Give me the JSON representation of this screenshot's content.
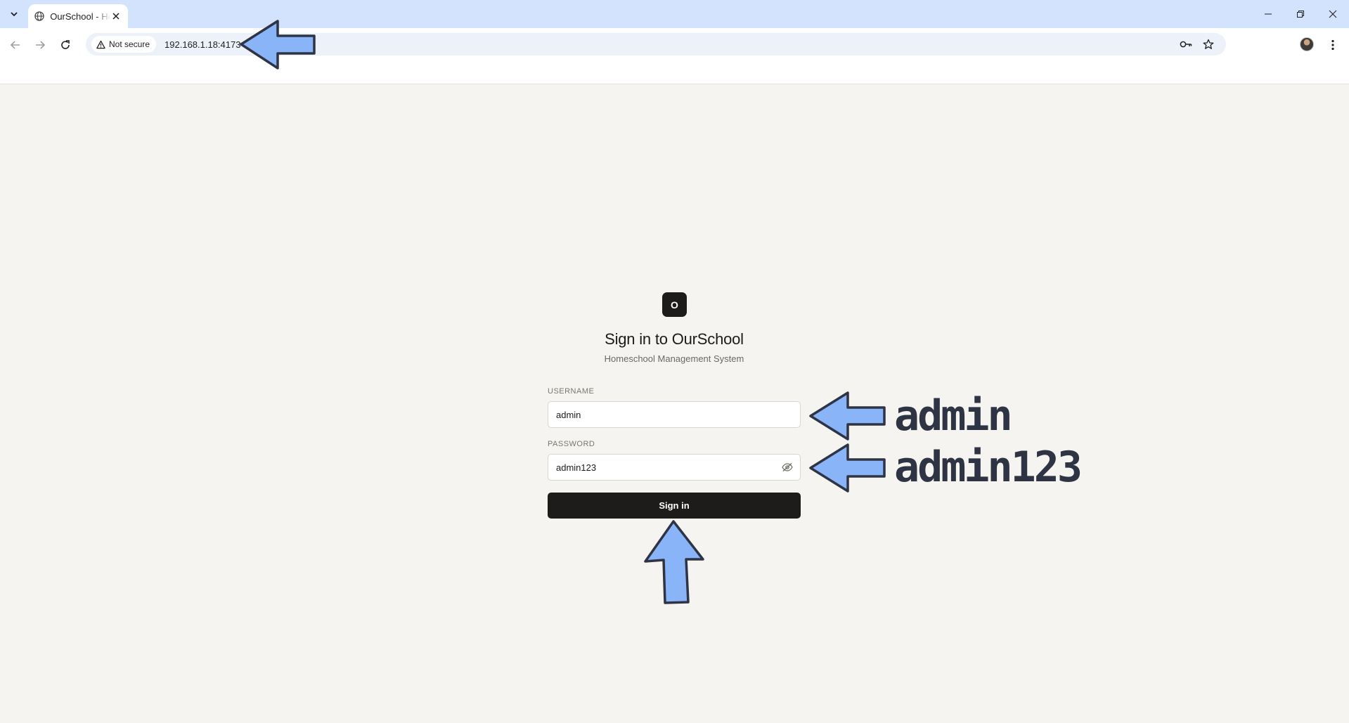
{
  "browser": {
    "tab_title": "OurSchool - Homeschool Management System",
    "security_label": "Not secure",
    "url": "192.168.1.18:4173"
  },
  "page": {
    "logo_letter": "O",
    "title": "Sign in to OurSchool",
    "subtitle": "Homeschool Management System",
    "username_label": "USERNAME",
    "username_value": "admin",
    "password_label": "PASSWORD",
    "password_value": "admin123",
    "signin_label": "Sign in"
  },
  "annotations": {
    "username_text": "admin",
    "password_text": "admin123",
    "arrow_color": "#8ab4f8"
  },
  "colors": {
    "chrome_bg": "#d3e3fd",
    "page_bg": "#f5f4f1",
    "primary": "#1d1c1a"
  }
}
